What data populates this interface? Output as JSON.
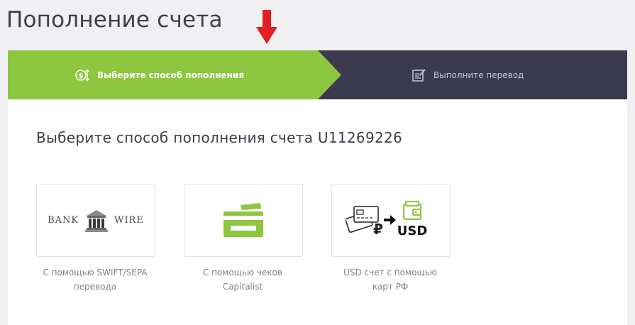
{
  "page": {
    "title": "Пополнение счета"
  },
  "stepper": {
    "active_color": "#8dc63f",
    "inactive_color": "#3b3a4e",
    "steps": [
      {
        "label": "Выберите способ пополнения",
        "icon": "money-arrows-icon",
        "active": true
      },
      {
        "label": "Выполните перевод",
        "icon": "edit-document-icon",
        "active": false
      }
    ]
  },
  "main": {
    "heading": "Выберите способ пополнения счета U11269226",
    "options": [
      {
        "icon": "bank-building-icon",
        "icon_text_left": "BANK",
        "icon_text_right": "WIRE",
        "caption_line1": "С помощью SWIFT/SEPA",
        "caption_line2": "перевода"
      },
      {
        "icon": "credit-card-icon",
        "caption_line1": "С помощью чеков",
        "caption_line2": "Capitalist"
      },
      {
        "icon": "card-ruble-to-usd-wallet-icon",
        "icon_text": "USD",
        "currency_symbol": "₽",
        "caption_line1": "USD счет с помощью",
        "caption_line2": "карт РФ"
      }
    ]
  },
  "annotation": {
    "icon": "red-down-arrow-icon",
    "color": "#e02020"
  }
}
